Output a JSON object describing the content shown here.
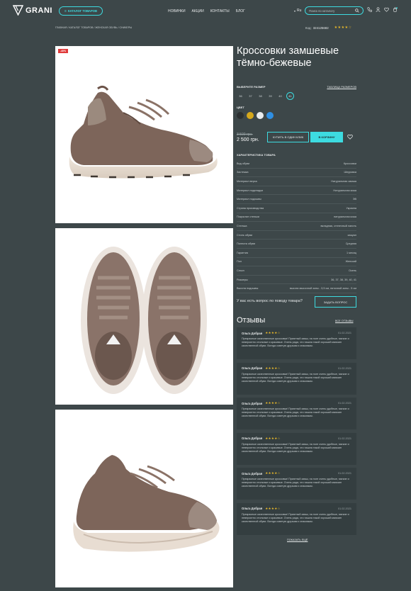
{
  "header": {
    "logo_text": "GRANI",
    "catalog_label": "КАТАЛОГ ТОВАРОВ",
    "nav": [
      "НОВИНКИ",
      "АКЦИИ",
      "КОНТАКТЫ",
      "БЛОГ"
    ],
    "lang": "Ru",
    "search_placeholder": "Поиск по каталогу",
    "accent_color": "#3ddbe0"
  },
  "breadcrumbs": "ГЛАВНАЯ / КАТАЛОГ ТОВАРОВ / ЖЕНСКАЯ ОБУВЬ / СНИКЕРЫ",
  "product_code": {
    "label": "Код:",
    "value": "324125682",
    "rating_stars": "★★★★☆"
  },
  "gallery": {
    "badge": "-40%"
  },
  "product": {
    "title": "Кроссовки замшевые тёмно-бежевые",
    "size_label": "ВЫБЕРИТЕ РАЗМЕР",
    "size_table_link": "ТАБЛИЦА РАЗМЕРОВ",
    "sizes": [
      "36",
      "37",
      "38",
      "39",
      "40",
      "41"
    ],
    "selected_size": "41",
    "color_label": "ЦВЕТ",
    "colors": [
      "#2b2f31",
      "#d6a81c",
      "#e9ecee",
      "#2f8fe3"
    ],
    "old_price": "3 500 грн.",
    "price": "2 500 грн.",
    "one_click_label": "КУПИТЬ В ОДИН КЛИК",
    "cart_label": "В КОРЗИНУ"
  },
  "specs": {
    "title": "ХАРАКТЕРИСТИКА ТОВАРА",
    "rows": [
      {
        "k": "Вид обуви",
        "v": "Кроссовки"
      },
      {
        "k": "Застежка",
        "v": "Шнуровка"
      },
      {
        "k": "Материал верха",
        "v": "Натуральная замша"
      },
      {
        "k": "Материал подкладки",
        "v": "Натуральная кожа"
      },
      {
        "k": "Материал подошвы",
        "v": "ЭВ"
      },
      {
        "k": "Страна производства",
        "v": "Украина"
      },
      {
        "k": "Покрытие стельки",
        "v": "натуральная кожа"
      },
      {
        "k": "Стелька",
        "v": "вкладная, стелечный лапоть"
      },
      {
        "k": "Стиль обуви",
        "v": "кэжуал"
      },
      {
        "k": "Полнота обуви",
        "v": "Средняя"
      },
      {
        "k": "Гарантия",
        "v": "1 месяц"
      },
      {
        "k": "Пол",
        "v": "Женский"
      },
      {
        "k": "Сезон",
        "v": "Осень"
      },
      {
        "k": "Размеры",
        "v": "36, 37, 38, 39, 40, 41"
      },
      {
        "k": "Высота подошвы",
        "v": "высота мысочной зоны - 3,5 см, пяточной зоны - 5 см"
      }
    ]
  },
  "question": {
    "text": "У вас есть вопрос по поводу товара?",
    "button": "ЗАДАТЬ ВОПРОС"
  },
  "reviews": {
    "title": "Отзывы",
    "all_link": "ВСЕ ОТЗЫВЫ",
    "items": [
      {
        "name": "Ольга Добрая",
        "stars": "★★★★☆",
        "date": "01.02.2021",
        "text": "Прекрасные качественные кроссовки! Приятный замш, на ноге очень удобные, мягкие и невероятно стильные и красивые. Очень рада, что нашла такой хороший магазин качественной обуви. Всегда советую друзьям и знакомым."
      },
      {
        "name": "Ольга Добрая",
        "stars": "★★★★☆",
        "date": "01.02.2021",
        "text": "Прекрасные качественные кроссовки! Приятный замш, на ноге очень удобные, мягкие и невероятно стильные и красивые. Очень рада, что нашла такой хороший магазин качественной обуви. Всегда советую друзьям и знакомым."
      },
      {
        "name": "Ольга Добрая",
        "stars": "★★★★☆",
        "date": "01.02.2021",
        "text": "Прекрасные качественные кроссовки! Приятный замш, на ноге очень удобные, мягкие и невероятно стильные и красивые. Очень рада, что нашла такой хороший магазин качественной обуви. Всегда советую друзьям и знакомым."
      },
      {
        "name": "Ольга Добрая",
        "stars": "★★★★☆",
        "date": "01.02.2021",
        "text": "Прекрасные качественные кроссовки! Приятный замш, на ноге очень удобные, мягкие и невероятно стильные и красивые. Очень рада, что нашла такой хороший магазин качественной обуви. Всегда советую друзьям и знакомым."
      },
      {
        "name": "Ольга Добрая",
        "stars": "★★★★☆",
        "date": "01.02.2021",
        "text": "Прекрасные качественные кроссовки! Приятный замш, на ноге очень удобные, мягкие и невероятно стильные и красивые. Очень рада, что нашла такой хороший магазин качественной обуви. Всегда советую друзьям и знакомым."
      },
      {
        "name": "Ольга Добрая",
        "stars": "★★★★☆",
        "date": "01.02.2021",
        "text": "Прекрасные качественные кроссовки! Приятный замш, на ноге очень удобные, мягкие и невероятно стильные и красивые. Очень рада, что нашла такой хороший магазин качественной обуви. Всегда советую друзьям и знакомым."
      }
    ],
    "more_label": "ПОКАЗАТЬ ЕЩЁ"
  }
}
